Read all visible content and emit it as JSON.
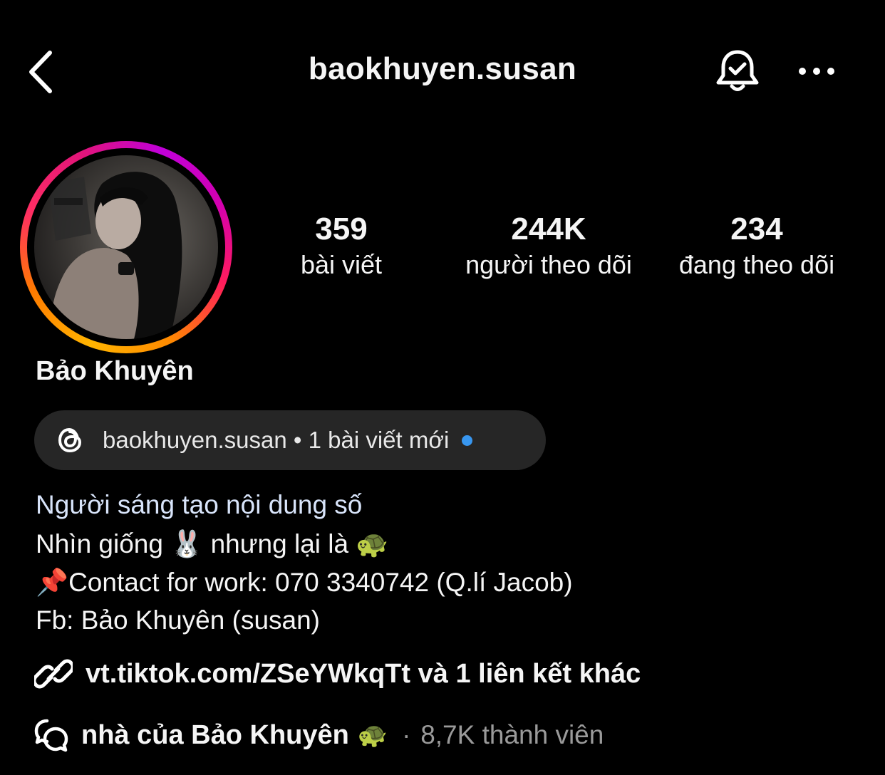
{
  "header": {
    "username": "baokhuyen.susan"
  },
  "stats": {
    "posts_count": "359",
    "posts_label": "bài viết",
    "followers_count": "244K",
    "followers_label": "người theo dõi",
    "following_count": "234",
    "following_label": "đang theo dõi"
  },
  "profile": {
    "display_name": "Bảo Khuyên"
  },
  "threads": {
    "text": "baokhuyen.susan • 1 bài viết mới",
    "dot_color": "#3897f0"
  },
  "bio": {
    "category": "Người sáng tạo nội dung số",
    "line1_a": "Nhìn giống",
    "line1_rabbit": "🐰",
    "line1_b": "nhưng lại là",
    "line1_turtle": "🐢",
    "line2_pin": "📌",
    "line2_text": "Contact for work: 070 3340742 (Q.lí Jacob)",
    "line3": "Fb: Bảo Khuyên (susan)"
  },
  "link": {
    "text": "vt.tiktok.com/ZSeYWkqTt và 1 liên kết khác"
  },
  "channel": {
    "name": "nhà của Bảo Khuyên",
    "emoji": "🐢",
    "separator": "·",
    "members": "8,7K thành viên"
  },
  "icons": {
    "back": "chevron-left-icon",
    "bell": "bell-check-icon",
    "more": "more-horizontal-icon",
    "threads": "threads-logo-icon",
    "link": "link-icon",
    "channel": "broadcast-channel-icon"
  },
  "colors": {
    "background": "#000000",
    "pill": "#262626",
    "category_text": "#d8e4fa",
    "muted_text": "#9a9a9a"
  }
}
